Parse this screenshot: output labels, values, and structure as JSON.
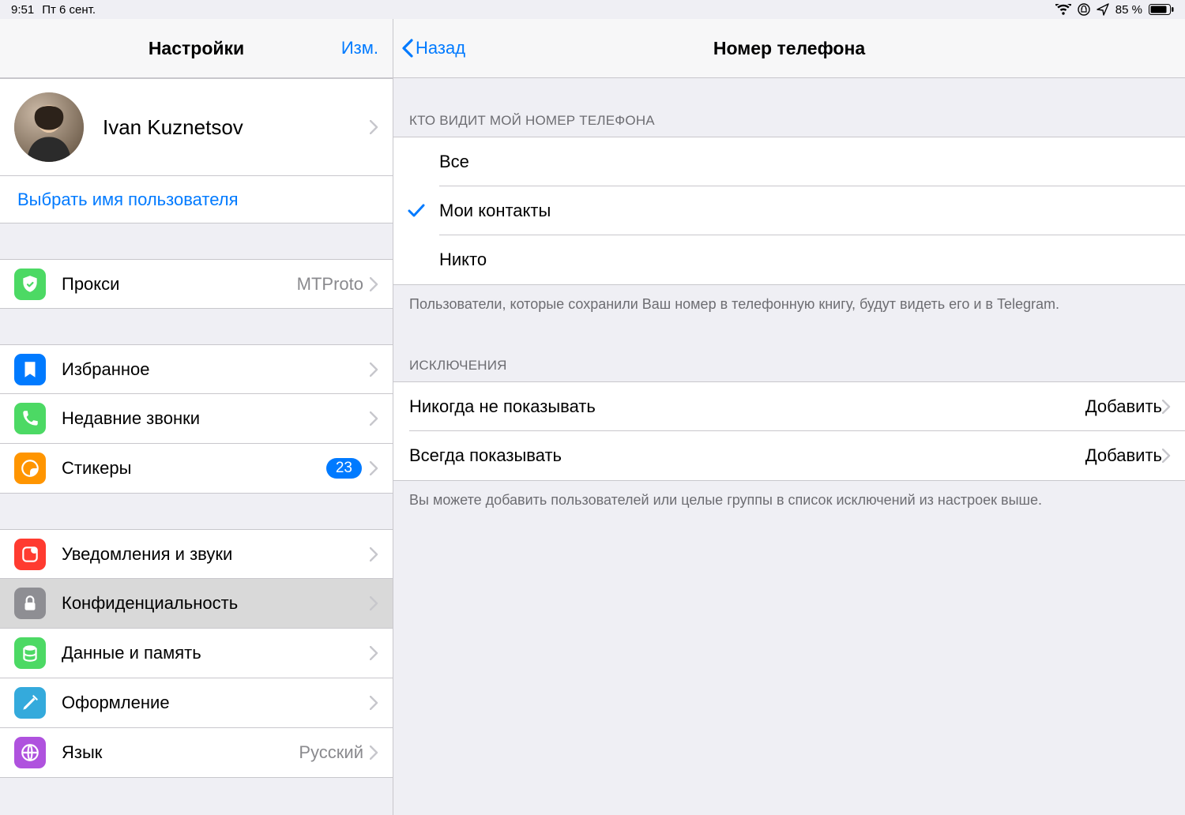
{
  "status": {
    "time": "9:51",
    "date": "Пт 6 сент.",
    "battery": "85 %"
  },
  "left": {
    "title": "Настройки",
    "edit": "Изм.",
    "profile_name": "Ivan Kuznetsov",
    "username_link": "Выбрать имя пользователя",
    "items": {
      "proxy": {
        "label": "Прокси",
        "value": "MTProto"
      },
      "saved": {
        "label": "Избранное"
      },
      "calls": {
        "label": "Недавние звонки"
      },
      "stickers": {
        "label": "Стикеры",
        "badge": "23"
      },
      "notif": {
        "label": "Уведомления и звуки"
      },
      "privacy": {
        "label": "Конфиденциальность"
      },
      "data": {
        "label": "Данные и память"
      },
      "appearance": {
        "label": "Оформление"
      },
      "language": {
        "label": "Язык",
        "value": "Русский"
      }
    }
  },
  "right": {
    "back": "Назад",
    "title": "Номер телефона",
    "section_who_sees": "КТО ВИДИТ МОЙ НОМЕР ТЕЛЕФОНА",
    "options": {
      "everybody": "Все",
      "contacts": "Мои контакты",
      "nobody": "Никто"
    },
    "who_footer": "Пользователи, которые сохранили Ваш номер в телефонную книгу, будут видеть его и в Telegram.",
    "section_exceptions": "ИСКЛЮЧЕНИЯ",
    "never_show": {
      "label": "Никогда не показывать",
      "value": "Добавить"
    },
    "always_show": {
      "label": "Всегда показывать",
      "value": "Добавить"
    },
    "exceptions_footer": "Вы можете добавить пользователей или целые группы в список исключений из настроек выше."
  }
}
